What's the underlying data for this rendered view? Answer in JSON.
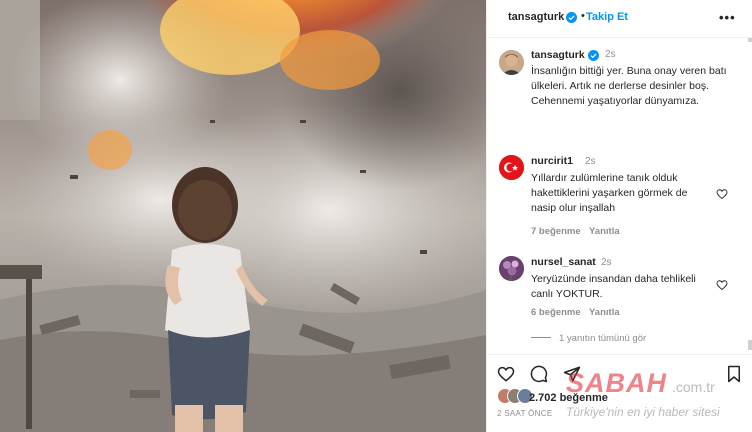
{
  "post": {
    "username": "tansagturk",
    "follow_label": "Takip Et",
    "more_label": "•••",
    "caption": {
      "username": "tansagturk",
      "time": "2s",
      "text": "İnsanlığın bittiği yer. Buna onay veren batı ülkeleri. Artık ne derlerse desinler boş. Cehennemi yaşatıyorlar dünyamıza."
    }
  },
  "comments": [
    {
      "username": "nurcirit1",
      "time": "2s",
      "text": "Yıllardır zulümlerine tanık olduk hakettiklerini yaşarken görmek de nasip olur inşallah",
      "likes": "7 beğenme",
      "reply_label": "Yanıtla"
    },
    {
      "username": "nursel_sanat",
      "time": "2s",
      "text": "Yeryüzünde insandan daha tehlikeli canlı YOKTUR.",
      "likes": "6 beğenme",
      "reply_label": "Yanıtla",
      "view_replies": "1 yanıtın tümünü gör"
    }
  ],
  "footer": {
    "likes_count": "2.702 beğenme",
    "post_age": "2 SAAT ÖNCE"
  },
  "watermark": {
    "brand": "SABAH",
    "domain": ".com.tr",
    "tagline": "Türkiye'nin en iyi haber sitesi"
  },
  "colors": {
    "accent": "#0095f6",
    "text": "#262626",
    "muted": "#8e8e8e"
  },
  "icons": [
    "verified-badge-icon",
    "more-options-icon",
    "heart-icon",
    "comment-icon",
    "share-icon",
    "bookmark-icon"
  ]
}
